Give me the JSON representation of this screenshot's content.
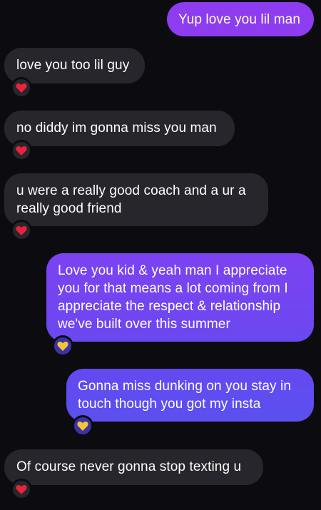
{
  "messages": [
    {
      "direction": "outgoing",
      "text": "Yup love you lil man",
      "reaction": null
    },
    {
      "direction": "incoming",
      "text": "love you too lil guy",
      "reaction": "red-heart"
    },
    {
      "direction": "incoming",
      "text": "no diddy im gonna miss you man",
      "reaction": "red-heart"
    },
    {
      "direction": "incoming",
      "text": "u were a really good coach and a ur a\nreally good friend",
      "reaction": "red-heart"
    },
    {
      "direction": "outgoing",
      "text": "Love you kid & yeah man I appreciate\nyou for that means a lot coming from I\nappreciate the respect & relationship\nwe've built over this summer",
      "reaction": "yellow-heart"
    },
    {
      "direction": "outgoing",
      "text": "Gonna miss dunking on you stay in\ntouch though you got my insta",
      "reaction": "yellow-heart"
    },
    {
      "direction": "incoming",
      "text": "Of course never gonna stop texting u",
      "reaction": "red-heart"
    }
  ],
  "colors": {
    "background": "#0c0c10",
    "incoming_bubble": "#26262c",
    "outgoing_gradient_top": "#8b3bef",
    "outgoing_gradient_bottom": "#5c4ff0",
    "red_heart": "#e8233a",
    "yellow_heart": "#f7c531"
  }
}
